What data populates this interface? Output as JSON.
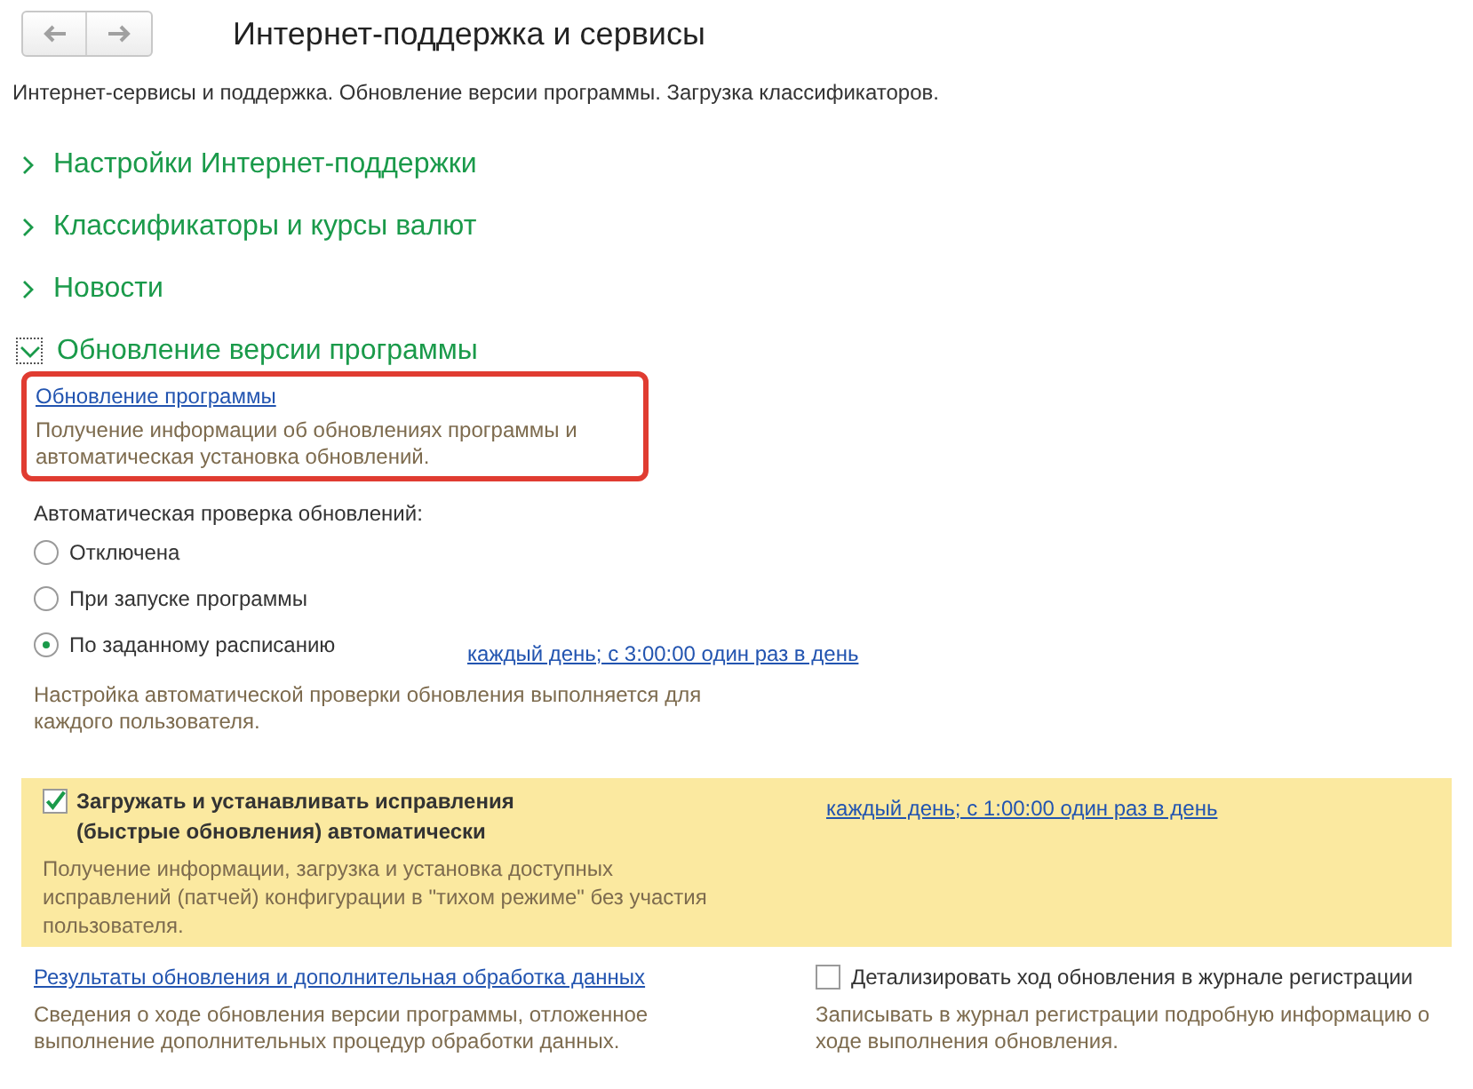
{
  "window": {
    "title": "Интернет-поддержка и сервисы"
  },
  "description": "Интернет-сервисы и поддержка. Обновление версии программы. Загрузка классификаторов.",
  "sections": [
    {
      "label": "Настройки Интернет-поддержки",
      "expanded": false
    },
    {
      "label": "Классификаторы и курсы валют",
      "expanded": false
    },
    {
      "label": "Новости",
      "expanded": false
    },
    {
      "label": "Обновление версии программы",
      "expanded": true
    }
  ],
  "update": {
    "link": "Обновление программы",
    "note": "Получение информации об обновлениях программы и автоматическая установка обновлений.",
    "auto_check_label": "Автоматическая проверка обновлений:",
    "options": [
      {
        "label": "Отключена",
        "selected": false
      },
      {
        "label": "При запуске программы",
        "selected": false
      },
      {
        "label": "По заданному расписанию",
        "selected": true,
        "schedule": "каждый день; с 3:00:00 один раз в день"
      }
    ],
    "auto_check_note": "Настройка автоматической проверки обновления выполняется для каждого пользователя.",
    "patches": {
      "label": "Загружать и устанавливать исправления (быстрые обновления) автоматически",
      "checked": true,
      "schedule": "каждый день; с 1:00:00 один раз в день",
      "note": "Получение информации, загрузка и установка доступных исправлений (патчей) конфигурации в \"тихом режиме\" без участия пользователя."
    },
    "results": {
      "link": "Результаты обновления и дополнительная обработка данных",
      "note": "Сведения о ходе обновления версии программы, отложенное выполнение дополнительных процедур обработки данных."
    },
    "detail_log": {
      "label": "Детализировать ход обновления в журнале регистрации",
      "checked": false,
      "note": "Записывать в журнал регистрации подробную информацию о ходе выполнения обновления."
    }
  }
}
